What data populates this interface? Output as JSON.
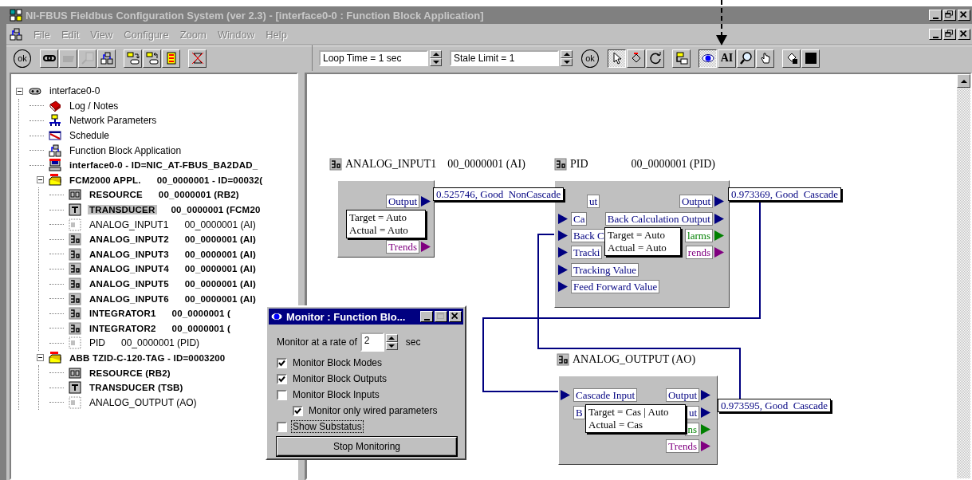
{
  "window": {
    "title": "NI-FBUS Fieldbus Configuration System (ver 2.3) - [interface0-0 : Function Block Application]"
  },
  "menu": [
    {
      "label": "File",
      "disabled": true
    },
    {
      "label": "Edit",
      "disabled": true
    },
    {
      "label": "View",
      "disabled": true
    },
    {
      "label": "Configure",
      "disabled": true
    },
    {
      "label": "Zoom",
      "disabled": true
    },
    {
      "label": "Window",
      "disabled": true
    },
    {
      "label": "Help",
      "disabled": true
    }
  ],
  "left_toolbar": {
    "groups": [
      [
        {
          "kind": "ok",
          "label": "ok",
          "disabled": false
        }
      ],
      [
        {
          "kind": "link",
          "disabled": false
        },
        {
          "kind": "block",
          "disabled": true
        },
        {
          "kind": "edit",
          "disabled": true
        },
        {
          "kind": "application",
          "disabled": false
        }
      ],
      [
        {
          "kind": "download",
          "disabled": false
        },
        {
          "kind": "upload",
          "disabled": false
        },
        {
          "kind": "list",
          "disabled": false
        }
      ],
      [
        {
          "kind": "stop",
          "disabled": false
        }
      ]
    ]
  },
  "loop_time": {
    "value": "Loop Time = 1 sec"
  },
  "stale_limit": {
    "value": "Stale Limit = 1"
  },
  "tool_palette": {
    "groups": [
      [
        {
          "kind": "ok",
          "label": "ok",
          "selected": false
        }
      ],
      [
        {
          "kind": "pointer",
          "selected": true
        },
        {
          "kind": "wire",
          "selected": false
        },
        {
          "kind": "loop",
          "selected": false
        }
      ],
      [
        {
          "kind": "place",
          "selected": false
        }
      ],
      [
        {
          "kind": "monitor",
          "selected": true
        },
        {
          "kind": "text",
          "label": "AI",
          "selected": false
        },
        {
          "kind": "zoom",
          "selected": false
        },
        {
          "kind": "hand",
          "selected": false
        }
      ],
      [
        {
          "kind": "paint",
          "selected": false
        },
        {
          "kind": "color",
          "selected": false
        }
      ]
    ]
  },
  "tree": [
    {
      "label": "interface0-0",
      "kind": "interface",
      "bold": false,
      "selected": false,
      "expanded": true,
      "children": [
        {
          "label": "Log / Notes",
          "kind": "notes",
          "bold": false,
          "selected": false
        },
        {
          "label": "Network Parameters",
          "kind": "network",
          "bold": false,
          "selected": false
        },
        {
          "label": "Schedule",
          "kind": "schedule",
          "bold": false,
          "selected": false
        },
        {
          "label": "Function Block Application",
          "kind": "application",
          "bold": false,
          "selected": false
        },
        {
          "label": "interface0-0 - ID=NIC_AT-FBUS_BA2DAD_",
          "kind": "computer",
          "bold": true,
          "selected": false
        },
        {
          "label": "FCM2000 APPL.",
          "detail": "00_0000001 - ID=00032(",
          "kind": "device",
          "bold": true,
          "selected": false,
          "expanded": true,
          "children": [
            {
              "label": "RESOURCE",
              "detail": "00_0000001 (RB2)",
              "kind": "resource",
              "bold": true,
              "selected": false
            },
            {
              "label": "TRANSDUCER",
              "detail": "00_0000001 (FCM20",
              "kind": "transducer",
              "bold": true,
              "selected": true
            },
            {
              "label": "ANALOG_INPUT1",
              "detail": "00_0000001 (AI)",
              "kind": "block",
              "bold": false,
              "selected": false
            },
            {
              "label": "ANALOG_INPUT2",
              "detail": "00_0000001 (AI)",
              "kind": "block",
              "bold": true,
              "selected": false
            },
            {
              "label": "ANALOG_INPUT3",
              "detail": "00_0000001 (AI)",
              "kind": "block",
              "bold": true,
              "selected": false
            },
            {
              "label": "ANALOG_INPUT4",
              "detail": "00_0000001 (AI)",
              "kind": "block",
              "bold": true,
              "selected": false
            },
            {
              "label": "ANALOG_INPUT5",
              "detail": "00_0000001 (AI)",
              "kind": "block",
              "bold": true,
              "selected": false
            },
            {
              "label": "ANALOG_INPUT6",
              "detail": "00_0000001 (AI)",
              "kind": "block",
              "bold": true,
              "selected": false
            },
            {
              "label": "INTEGRATOR1",
              "detail": "00_0000001 (",
              "kind": "block",
              "bold": true,
              "selected": false
            },
            {
              "label": "INTEGRATOR2",
              "detail": "00_0000001 (",
              "kind": "block",
              "bold": true,
              "selected": false
            },
            {
              "label": "PID",
              "detail": "00_0000001 (PID)",
              "kind": "block",
              "bold": false,
              "selected": false
            }
          ]
        },
        {
          "label": "ABB TZID-C-120-TAG - ID=0003200",
          "kind": "device",
          "bold": true,
          "selected": false,
          "expanded": true,
          "children": [
            {
              "label": "RESOURCE (RB2)",
              "kind": "resource",
              "bold": true,
              "selected": false
            },
            {
              "label": "TRANSDUCER (TSB)",
              "kind": "transducer",
              "bold": true,
              "selected": false
            },
            {
              "label": "ANALOG_OUTPUT (AO)",
              "kind": "block",
              "bold": false,
              "selected": false
            }
          ]
        }
      ]
    }
  ],
  "diagram": {
    "blocks": [
      {
        "title": "ANALOG_INPUT1",
        "address": "00_0000001 (AI)",
        "params": [
          {
            "label": "Output",
            "kind": "output"
          },
          {
            "label": "Trends",
            "kind": "trend"
          }
        ],
        "mode": {
          "target": "Target = Auto",
          "actual": "Actual = Auto"
        },
        "value": "0.525746, Good  NonCascade"
      },
      {
        "title": "PID",
        "address": "00_0000001 (PID)",
        "params": [
          {
            "label": "ut",
            "kind": "input"
          },
          {
            "label": "Output",
            "kind": "output"
          },
          {
            "label": "Ca",
            "kind": "input"
          },
          {
            "label": "Back Calculation Output",
            "kind": "output"
          },
          {
            "label": "Back C",
            "kind": "input"
          },
          {
            "label": "larms",
            "kind": "alarm"
          },
          {
            "label": "Tracki",
            "kind": "input"
          },
          {
            "label": "rends",
            "kind": "trend"
          },
          {
            "label": "Tracking Value",
            "kind": "input"
          },
          {
            "label": "Feed Forward Value",
            "kind": "input"
          }
        ],
        "mode": {
          "target": "Target = Auto",
          "actual": "Actual = Auto"
        },
        "value": "0.973369, Good  Cascade"
      },
      {
        "title": "ANALOG_OUTPUT (AO)",
        "params": [
          {
            "label": "Cascade Input",
            "kind": "input"
          },
          {
            "label": "Output",
            "kind": "output"
          },
          {
            "label": "B",
            "kind": "input"
          },
          {
            "label": "ut",
            "kind": "output"
          },
          {
            "label": "ns",
            "kind": "alarm"
          },
          {
            "label": "Trends",
            "kind": "trend"
          }
        ],
        "mode": {
          "target": "Target = Cas | Auto",
          "actual": "Actual = Cas"
        },
        "value": "0.973595, Good  Cascade"
      }
    ]
  },
  "monitor_dialog": {
    "title": "Monitor : Function Blo...",
    "rate_label": "Monitor at a rate of",
    "rate": "2",
    "rate_unit": "sec",
    "options": [
      {
        "label": "Monitor Block Modes",
        "checked": true,
        "focused": false
      },
      {
        "label": "Monitor Block Outputs",
        "checked": true,
        "focused": false
      },
      {
        "label": "Monitor Block Inputs",
        "checked": false,
        "focused": false,
        "children": [
          {
            "label": "Monitor only wired parameters",
            "checked": true,
            "focused": false
          }
        ]
      },
      {
        "label": "Show Substatus",
        "checked": false,
        "focused": true
      }
    ],
    "button": "Stop Monitoring"
  }
}
